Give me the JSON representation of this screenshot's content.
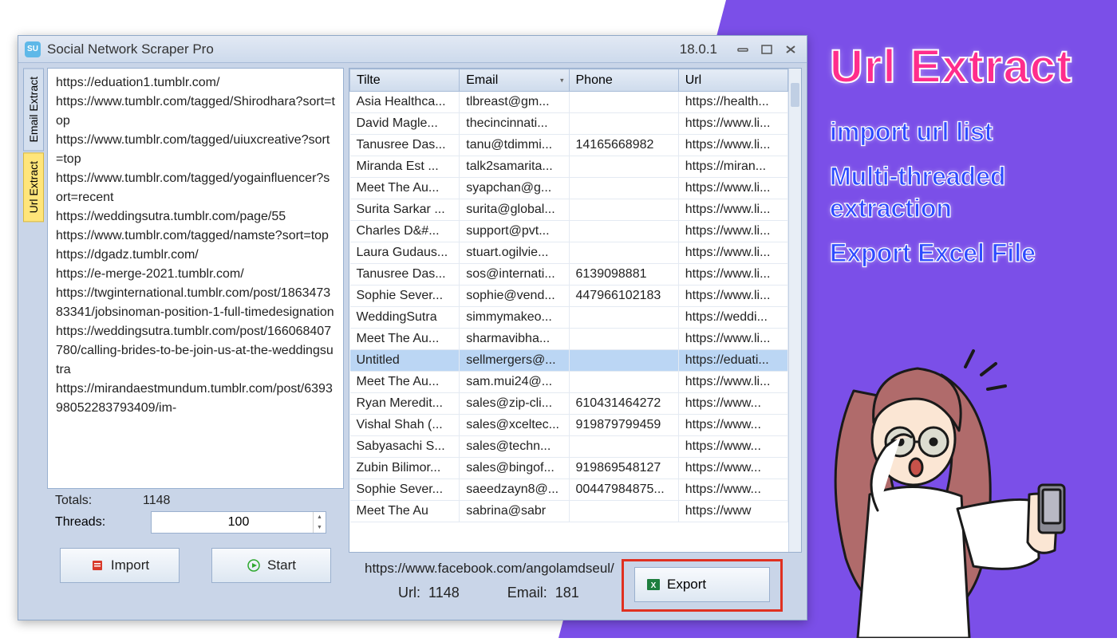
{
  "titlebar": {
    "app_name": "Social Network Scraper Pro",
    "version": "18.0.1"
  },
  "side_tabs": {
    "email_extract": "Email Extract",
    "url_extract": "Url Extract"
  },
  "url_textarea": "https://eduation1.tumblr.com/\nhttps://www.tumblr.com/tagged/Shirodhara?sort=top\nhttps://www.tumblr.com/tagged/uiuxcreative?sort=top\nhttps://www.tumblr.com/tagged/yogainfluencer?sort=recent\nhttps://weddingsutra.tumblr.com/page/55\nhttps://www.tumblr.com/tagged/namste?sort=top\nhttps://dgadz.tumblr.com/\nhttps://e-merge-2021.tumblr.com/\nhttps://twginternational.tumblr.com/post/186347383341/jobsinoman-position-1-full-timedesignation\nhttps://weddingsutra.tumblr.com/post/166068407780/calling-brides-to-be-join-us-at-the-weddingsutra\nhttps://mirandaestmundum.tumblr.com/post/639398052283793409/im-",
  "left_stats": {
    "totals_label": "Totals:",
    "totals_value": "1148",
    "threads_label": "Threads:",
    "threads_value": "100"
  },
  "buttons": {
    "import": "Import",
    "start": "Start",
    "export": "Export"
  },
  "grid": {
    "headers": {
      "title": "Tilte",
      "email": "Email",
      "phone": "Phone",
      "url": "Url"
    },
    "rows": [
      {
        "title": "Asia Healthca...",
        "email": "tlbreast@gm...",
        "phone": "",
        "url": "https://health..."
      },
      {
        "title": "David Magle...",
        "email": "thecincinnati...",
        "phone": "",
        "url": "https://www.li..."
      },
      {
        "title": "Tanusree Das...",
        "email": "tanu@tdimmi...",
        "phone": "14165668982",
        "url": "https://www.li..."
      },
      {
        "title": "Miranda Est ...",
        "email": "talk2samarita...",
        "phone": "",
        "url": "https://miran..."
      },
      {
        "title": "Meet The Au...",
        "email": "syapchan@g...",
        "phone": "",
        "url": "https://www.li..."
      },
      {
        "title": "Surita Sarkar ...",
        "email": "surita@global...",
        "phone": "",
        "url": "https://www.li..."
      },
      {
        "title": "Charles D&#...",
        "email": "support@pvt...",
        "phone": "",
        "url": "https://www.li..."
      },
      {
        "title": "Laura Gudaus...",
        "email": "stuart.ogilvie...",
        "phone": "",
        "url": "https://www.li..."
      },
      {
        "title": "Tanusree Das...",
        "email": "sos@internati...",
        "phone": "6139098881",
        "url": "https://www.li..."
      },
      {
        "title": "Sophie Sever...",
        "email": "sophie@vend...",
        "phone": "447966102183",
        "url": "https://www.li..."
      },
      {
        "title": "WeddingSutra",
        "email": "simmymakeo...",
        "phone": "",
        "url": "https://weddi..."
      },
      {
        "title": "Meet The Au...",
        "email": "sharmavibha...",
        "phone": "",
        "url": "https://www.li..."
      },
      {
        "title": "Untitled",
        "email": "sellmergers@...",
        "phone": "",
        "url": "https://eduati...",
        "selected": true
      },
      {
        "title": "Meet The Au...",
        "email": "sam.mui24@...",
        "phone": "",
        "url": "https://www.li..."
      },
      {
        "title": "Ryan Meredit...",
        "email": "sales@zip-cli...",
        "phone": "610431464272",
        "url": "https://www..."
      },
      {
        "title": "Vishal Shah (...",
        "email": "sales@xceltec...",
        "phone": "919879799459",
        "url": "https://www..."
      },
      {
        "title": "Sabyasachi S...",
        "email": "sales@techn...",
        "phone": "",
        "url": "https://www..."
      },
      {
        "title": "Zubin Bilimor...",
        "email": "sales@bingof...",
        "phone": "919869548127",
        "url": "https://www..."
      },
      {
        "title": "Sophie Sever...",
        "email": "saeedzayn8@...",
        "phone": "00447984875...",
        "url": "https://www..."
      },
      {
        "title": "Meet The Au",
        "email": "sabrina@sabr",
        "phone": "",
        "url": "https://www"
      }
    ]
  },
  "status": {
    "current_url": "https://www.facebook.com/angolamdseul/",
    "url_label": "Url:",
    "url_count": "1148",
    "email_label": "Email:",
    "email_count": "181"
  },
  "promo": {
    "title": "Url Extract",
    "line1": "import url list",
    "line2": "Multi-threaded extraction",
    "line3": "Export Excel File"
  }
}
